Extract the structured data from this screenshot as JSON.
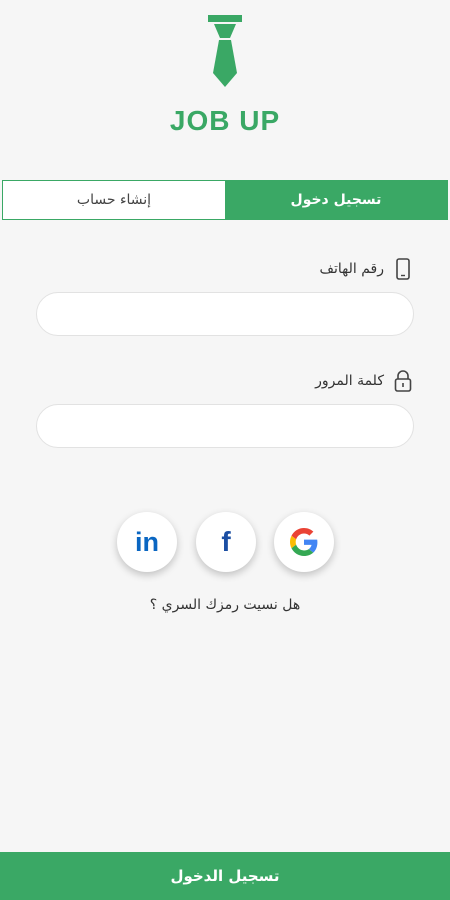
{
  "brand": {
    "name": "JOB UP",
    "logo_icon": "tie-icon",
    "color": "#3aa865"
  },
  "tabs": {
    "signup_label": "إنشاء حساب",
    "login_label": "تسجيل دخول",
    "active": "login"
  },
  "phone": {
    "label": "رقم الهاتف",
    "icon": "phone-icon",
    "value": "",
    "placeholder": ""
  },
  "password": {
    "label": "كلمة المرور",
    "icon": "lock-icon",
    "value": "",
    "placeholder": ""
  },
  "social": {
    "linkedin_text": "in",
    "facebook_text": "f",
    "google_text": "G",
    "linkedin_color": "#0a66c2",
    "facebook_color": "#1b4ea3"
  },
  "forgot_label": "هل نسيت رمزك السري ؟",
  "submit_label": "تسجيل الدخول"
}
